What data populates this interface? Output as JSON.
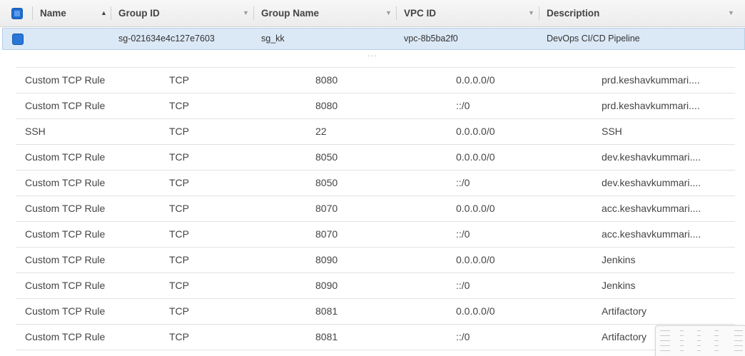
{
  "security_groups": {
    "columns": [
      "Name",
      "Group ID",
      "Group Name",
      "VPC ID",
      "Description"
    ],
    "selected_row": {
      "name": "",
      "group_id": "sg-021634e4c127e7603",
      "group_name": "sg_kk",
      "vpc_id": "vpc-8b5ba2f0",
      "description": "DevOps CI/CD Pipeline"
    }
  },
  "inbound_rules": [
    {
      "type": "Custom TCP Rule",
      "protocol": "TCP",
      "port": "8080",
      "source": "0.0.0.0/0",
      "description": "prd.keshavkummari...."
    },
    {
      "type": "Custom TCP Rule",
      "protocol": "TCP",
      "port": "8080",
      "source": "::/0",
      "description": "prd.keshavkummari...."
    },
    {
      "type": "SSH",
      "protocol": "TCP",
      "port": "22",
      "source": "0.0.0.0/0",
      "description": "SSH"
    },
    {
      "type": "Custom TCP Rule",
      "protocol": "TCP",
      "port": "8050",
      "source": "0.0.0.0/0",
      "description": "dev.keshavkummari...."
    },
    {
      "type": "Custom TCP Rule",
      "protocol": "TCP",
      "port": "8050",
      "source": "::/0",
      "description": "dev.keshavkummari...."
    },
    {
      "type": "Custom TCP Rule",
      "protocol": "TCP",
      "port": "8070",
      "source": "0.0.0.0/0",
      "description": "acc.keshavkummari...."
    },
    {
      "type": "Custom TCP Rule",
      "protocol": "TCP",
      "port": "8070",
      "source": "::/0",
      "description": "acc.keshavkummari...."
    },
    {
      "type": "Custom TCP Rule",
      "protocol": "TCP",
      "port": "8090",
      "source": "0.0.0.0/0",
      "description": "Jenkins"
    },
    {
      "type": "Custom TCP Rule",
      "protocol": "TCP",
      "port": "8090",
      "source": "::/0",
      "description": "Jenkins"
    },
    {
      "type": "Custom TCP Rule",
      "protocol": "TCP",
      "port": "8081",
      "source": "0.0.0.0/0",
      "description": "Artifactory"
    },
    {
      "type": "Custom TCP Rule",
      "protocol": "TCP",
      "port": "8081",
      "source": "::/0",
      "description": "Artifactory"
    }
  ],
  "icons": {
    "select_all": "checkbox-icon",
    "sort_asc": "sort-ascending-icon",
    "column_menu": "caret-down-icon",
    "resize_grip": "drag-handle-icon"
  },
  "colors": {
    "selected_row_bg": "#dbe8f6",
    "checkbox_blue": "#2a76d6"
  }
}
